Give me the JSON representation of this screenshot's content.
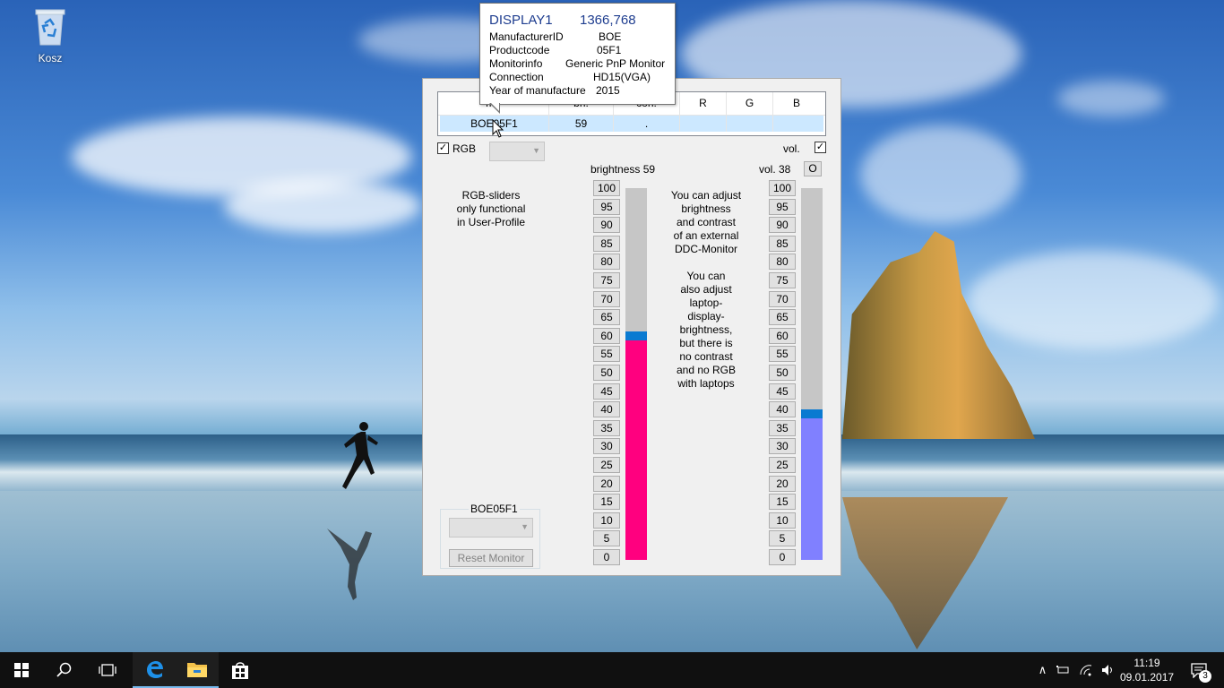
{
  "desktop": {
    "icons": [
      {
        "label": "Kosz",
        "icon": "recycle-bin-icon"
      }
    ]
  },
  "tooltip": {
    "title": "DISPLAY1",
    "resolution": "1366,768",
    "rows": [
      {
        "label": "ManufacturerID",
        "value": "BOE"
      },
      {
        "label": "Productcode",
        "value": "05F1"
      },
      {
        "label": "Monitorinfo",
        "value": "Generic PnP Monitor"
      },
      {
        "label": "Connection",
        "value": "HD15(VGA)"
      },
      {
        "label": "Year of manufacture",
        "value": "2015"
      }
    ]
  },
  "grid": {
    "headers": [
      "mo",
      "bri.",
      "con.",
      "R",
      "G",
      "B"
    ],
    "rows": [
      {
        "monitor": "BOE05F1",
        "brightness": "59",
        "contrast": ".",
        "r": "",
        "g": "",
        "b": ""
      }
    ]
  },
  "controls": {
    "rgb_label": "RGB",
    "rgb_checked": "✓",
    "vol_label": "vol.",
    "vol_checked": "✓",
    "brightness_label": "brightness 59",
    "volume_label": "vol. 38",
    "o_button": "O",
    "rgb_info": [
      "RGB-sliders",
      "only functional",
      "in User-Profile"
    ],
    "center_info": [
      "You can adjust",
      "brightness",
      "and contrast",
      "of an external",
      "DDC-Monitor",
      "",
      "You can",
      "also adjust",
      "laptop-",
      "display-",
      "brightness,",
      "but there is",
      "no contrast",
      "and no RGB",
      "with laptops"
    ],
    "scale": [
      "100",
      "95",
      "90",
      "85",
      "80",
      "75",
      "70",
      "65",
      "60",
      "55",
      "50",
      "45",
      "40",
      "35",
      "30",
      "25",
      "20",
      "15",
      "10",
      "5",
      "0"
    ],
    "brightness_value": 59,
    "volume_value": 38,
    "brightness_color": "#ff007f",
    "volume_color": "#8080ff",
    "thumb_color": "#0a7ad1",
    "group_title": "BOE05F1",
    "reset_button": "Reset Monitor"
  },
  "taskbar": {
    "time": "11:19",
    "date": "09.01.2017",
    "notifications": "3",
    "items": [
      "windows-start-icon",
      "search-icon",
      "task-view-icon",
      "edge-icon",
      "file-explorer-icon",
      "store-icon"
    ]
  }
}
